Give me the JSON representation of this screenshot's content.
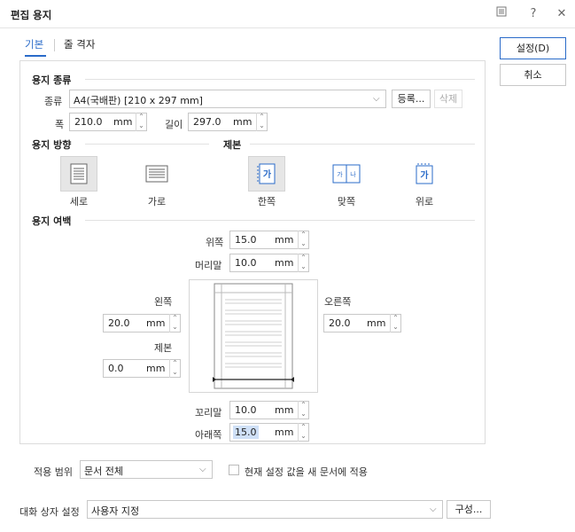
{
  "window": {
    "title": "편집 용지"
  },
  "titlebar_icons": [
    "restore-icon",
    "help-icon",
    "close-icon"
  ],
  "tabs": [
    {
      "label": "기본",
      "active": true
    },
    {
      "label": "줄 격자",
      "active": false
    }
  ],
  "paper_type": {
    "section_title": "용지 종류",
    "type_label": "종류",
    "type_value": "A4(국배판) [210 x 297 mm]",
    "register_button": "등록...",
    "delete_button": "삭제",
    "width_label": "폭",
    "width_value": "210.0",
    "width_unit": "mm",
    "length_label": "길이",
    "length_value": "297.0",
    "length_unit": "mm"
  },
  "orientation": {
    "section_title": "용지 방향",
    "options": [
      {
        "label": "세로",
        "selected": true
      },
      {
        "label": "가로",
        "selected": false
      }
    ]
  },
  "binding": {
    "section_title": "제본",
    "options": [
      {
        "label": "한쪽",
        "selected": true,
        "glyph": "가"
      },
      {
        "label": "맞쪽",
        "selected": false,
        "glyph": "가나"
      },
      {
        "label": "위로",
        "selected": false,
        "glyph": "가"
      }
    ]
  },
  "margins": {
    "section_title": "용지 여백",
    "top_label": "위쪽",
    "top_value": "15.0",
    "header_label": "머리말",
    "header_value": "10.0",
    "left_label": "왼쪽",
    "left_value": "20.0",
    "right_label": "오른쪽",
    "right_value": "20.0",
    "gutter_label": "제본",
    "gutter_value": "0.0",
    "footer_label": "꼬리말",
    "footer_value": "10.0",
    "bottom_label": "아래쪽",
    "bottom_value": "15.0",
    "unit": "mm"
  },
  "apply": {
    "label": "적용 범위",
    "value": "문서 전체",
    "checkbox_label": "현재 설정 값을 새 문서에 적용",
    "checked": false
  },
  "dialog_setting": {
    "label": "대화 상자 설정",
    "value": "사용자 지정",
    "configure_button": "구성..."
  },
  "buttons": {
    "ok": "설정(D)",
    "cancel": "취소"
  },
  "colors": {
    "accent": "#2a6bc9",
    "selected_tile": "#e6e6e6",
    "highlight": "#cfe0f7"
  }
}
